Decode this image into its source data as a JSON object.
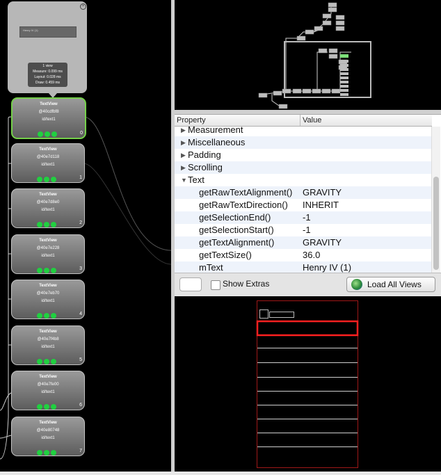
{
  "left_tree": {
    "popup": {
      "preview_text": "Henry IV (1)",
      "stats": {
        "views": "1 view",
        "measure": "Measure: 0.099 ms",
        "layout": "Layout: 0.028 ms",
        "draw": "Draw: 0.459 ms"
      }
    },
    "nodes": [
      {
        "type": "TextView",
        "hash": "@40cdfbf8",
        "id": "id/text1",
        "index": "0"
      },
      {
        "type": "TextView",
        "hash": "@40e7d118",
        "id": "id/text1",
        "index": "1"
      },
      {
        "type": "TextView",
        "hash": "@40e7d8e0",
        "id": "id/text1",
        "index": "2"
      },
      {
        "type": "TextView",
        "hash": "@40e7e228",
        "id": "id/text1",
        "index": "3"
      },
      {
        "type": "TextView",
        "hash": "@40e7eb70",
        "id": "id/text1",
        "index": "4"
      },
      {
        "type": "TextView",
        "hash": "@40e7f4b8",
        "id": "id/text1",
        "index": "5"
      },
      {
        "type": "TextView",
        "hash": "@40e7fe00",
        "id": "id/text1",
        "index": "6"
      },
      {
        "type": "TextView",
        "hash": "@40e80748",
        "id": "id/text1",
        "index": "7"
      }
    ],
    "selected_index": 0,
    "selection_color": "#75d04a",
    "indicator_color": "#20d040"
  },
  "properties": {
    "header": {
      "property": "Property",
      "value": "Value"
    },
    "rows": [
      {
        "kind": "category",
        "label": "Measurement",
        "expanded": false
      },
      {
        "kind": "category",
        "label": "Miscellaneous",
        "expanded": false
      },
      {
        "kind": "category",
        "label": "Padding",
        "expanded": false
      },
      {
        "kind": "category",
        "label": "Scrolling",
        "expanded": false
      },
      {
        "kind": "category",
        "label": "Text",
        "expanded": true
      },
      {
        "kind": "prop",
        "name": "getRawTextAlignment()",
        "value": "GRAVITY"
      },
      {
        "kind": "prop",
        "name": "getRawTextDirection()",
        "value": "INHERIT"
      },
      {
        "kind": "prop",
        "name": "getSelectionEnd()",
        "value": "-1"
      },
      {
        "kind": "prop",
        "name": "getSelectionStart()",
        "value": "-1"
      },
      {
        "kind": "prop",
        "name": "getTextAlignment()",
        "value": "GRAVITY"
      },
      {
        "kind": "prop",
        "name": "getTextSize()",
        "value": "36.0"
      },
      {
        "kind": "prop",
        "name": "mText",
        "value": "Henry IV (1)"
      }
    ]
  },
  "toolbar": {
    "show_extras_label": "Show Extras",
    "show_extras_checked": false,
    "load_all_views_label": "Load All Views",
    "load_icon": "globe-icon"
  },
  "preview": {
    "outline_color": "#a01818",
    "selected_color": "#ff2020"
  }
}
